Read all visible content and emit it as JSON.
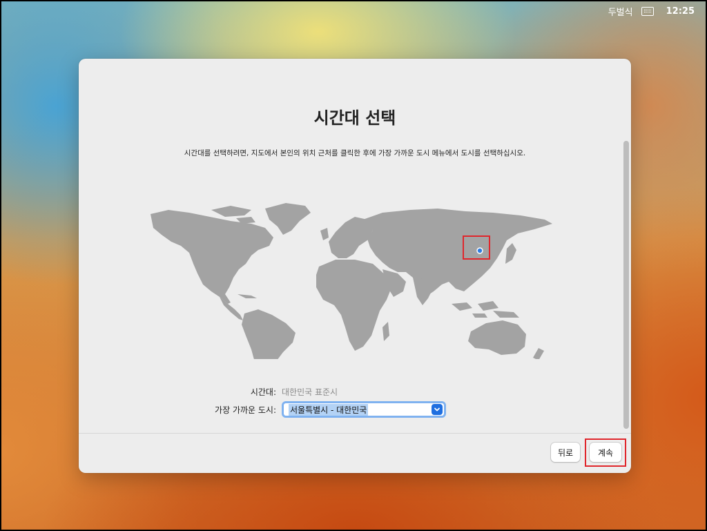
{
  "menubar": {
    "input_source": "두벌식",
    "clock": "12:25"
  },
  "window": {
    "title": "시간대 선택",
    "subtitle": "시간대를 선택하려면, 지도에서 본인의 위치 근처를 클릭한 후에 가장 가까운 도시 메뉴에서 도시를 선택하십시오.",
    "timezone": {
      "label": "시간대:",
      "value": "대한민국 표준시"
    },
    "city": {
      "label": "가장 가까운 도시:",
      "value": "서울특별시 - 대한민국"
    },
    "buttons": {
      "back": "뒤로",
      "continue": "계속"
    }
  },
  "colors": {
    "land": "#a3a3a3",
    "accent": "#1f6fe0",
    "marker": "#2f7de1",
    "highlight": "#e0262c"
  }
}
